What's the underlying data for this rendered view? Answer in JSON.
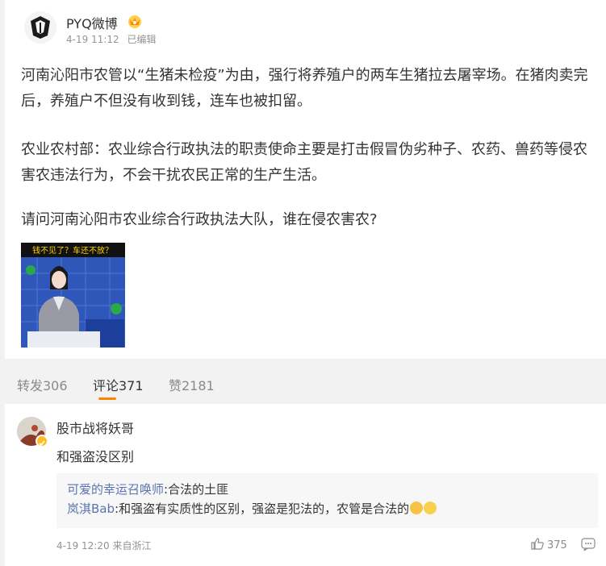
{
  "post": {
    "author": "PYQ微博",
    "time": "4-19 11:12",
    "edited": "已编辑",
    "para1": "河南沁阳市农管以“生猪未检疫”为由，强行将养殖户的两车生猪拉去屠宰场。在猪肉卖完后，养殖户不但没有收到钱，连车也被扣留。",
    "para2": "农业农村部：农业综合行政执法的职责使命主要是打击假冒伪劣种子、农药、兽药等侵农害农违法行为，不会干扰农民正常的生产生活。",
    "para3": "请问河南沁阳市农业综合行政执法大队，谁在侵农害农?",
    "thumb_caption": "钱不见了？车还不放？"
  },
  "tabs": {
    "repost": "转发306",
    "comment": "评论371",
    "like": "赞2181"
  },
  "comment": {
    "name": "股市战将妖哥",
    "text": "和强盗没区别",
    "replies": [
      {
        "user": "可爱的幸运召唤师",
        "text": ":合法的土匪"
      },
      {
        "user": "岚淇Bab",
        "text": ":和强盗有实质性的区别，强盗是犯法的，农管是合法的"
      }
    ],
    "time": "4-19 12:20 来自浙江",
    "likes": "375"
  },
  "icons": {
    "vip": "vip-crown-icon",
    "verified": "verified-badge-icon",
    "like": "thumbs-up-icon",
    "more": "more-dots-icon"
  },
  "colors": {
    "link": "#5b74b0",
    "accent": "#ff8200",
    "badge": "#ffbe22"
  }
}
